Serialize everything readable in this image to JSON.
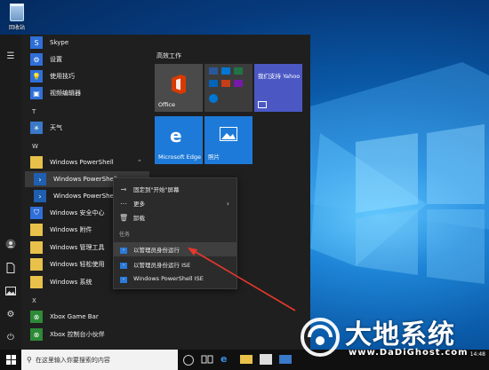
{
  "desktop": {
    "recycle_bin_label": "回收站"
  },
  "app_list": {
    "items": [
      {
        "label": "Skype"
      },
      {
        "label": "设置"
      },
      {
        "label": "使用技巧"
      },
      {
        "label": "视频编辑器"
      },
      {
        "label": "天气"
      },
      {
        "label": "Windows PowerShell"
      },
      {
        "label": "Windows PowerShell"
      },
      {
        "label": "Windows PowerShell"
      },
      {
        "label": "Windows 安全中心"
      },
      {
        "label": "Windows 附件"
      },
      {
        "label": "Windows 管理工具"
      },
      {
        "label": "Windows 轻松使用"
      },
      {
        "label": "Windows 系统"
      },
      {
        "label": "Xbox Game Bar"
      },
      {
        "label": "Xbox 控制台小伙伴"
      }
    ],
    "section_t": "T",
    "section_w": "W",
    "section_x": "X"
  },
  "tiles": {
    "group_title": "高效工作",
    "office_label": "Office",
    "yahoo_text": "我们支持 Yahoo",
    "edge_label": "Microsoft Edge",
    "photos_label": "照片"
  },
  "context_menu": {
    "pin_start": "固定到\"开始\"屏幕",
    "more": "更多",
    "uninstall": "卸载",
    "tasks_header": "任务",
    "run_admin": "以管理员身份运行",
    "run_admin_ise": "以管理员身份运行 ISE",
    "ps_ise": "Windows PowerShell ISE"
  },
  "taskbar": {
    "search_placeholder": "在这里输入你要搜索的内容",
    "time": "14:48"
  },
  "watermark": {
    "brand": "大地系统",
    "url": "www.DaDiGhost.com"
  },
  "colors": {
    "accent": "#2f6fd8",
    "annotation": "#e8382a",
    "folder": "#e8c14a"
  }
}
